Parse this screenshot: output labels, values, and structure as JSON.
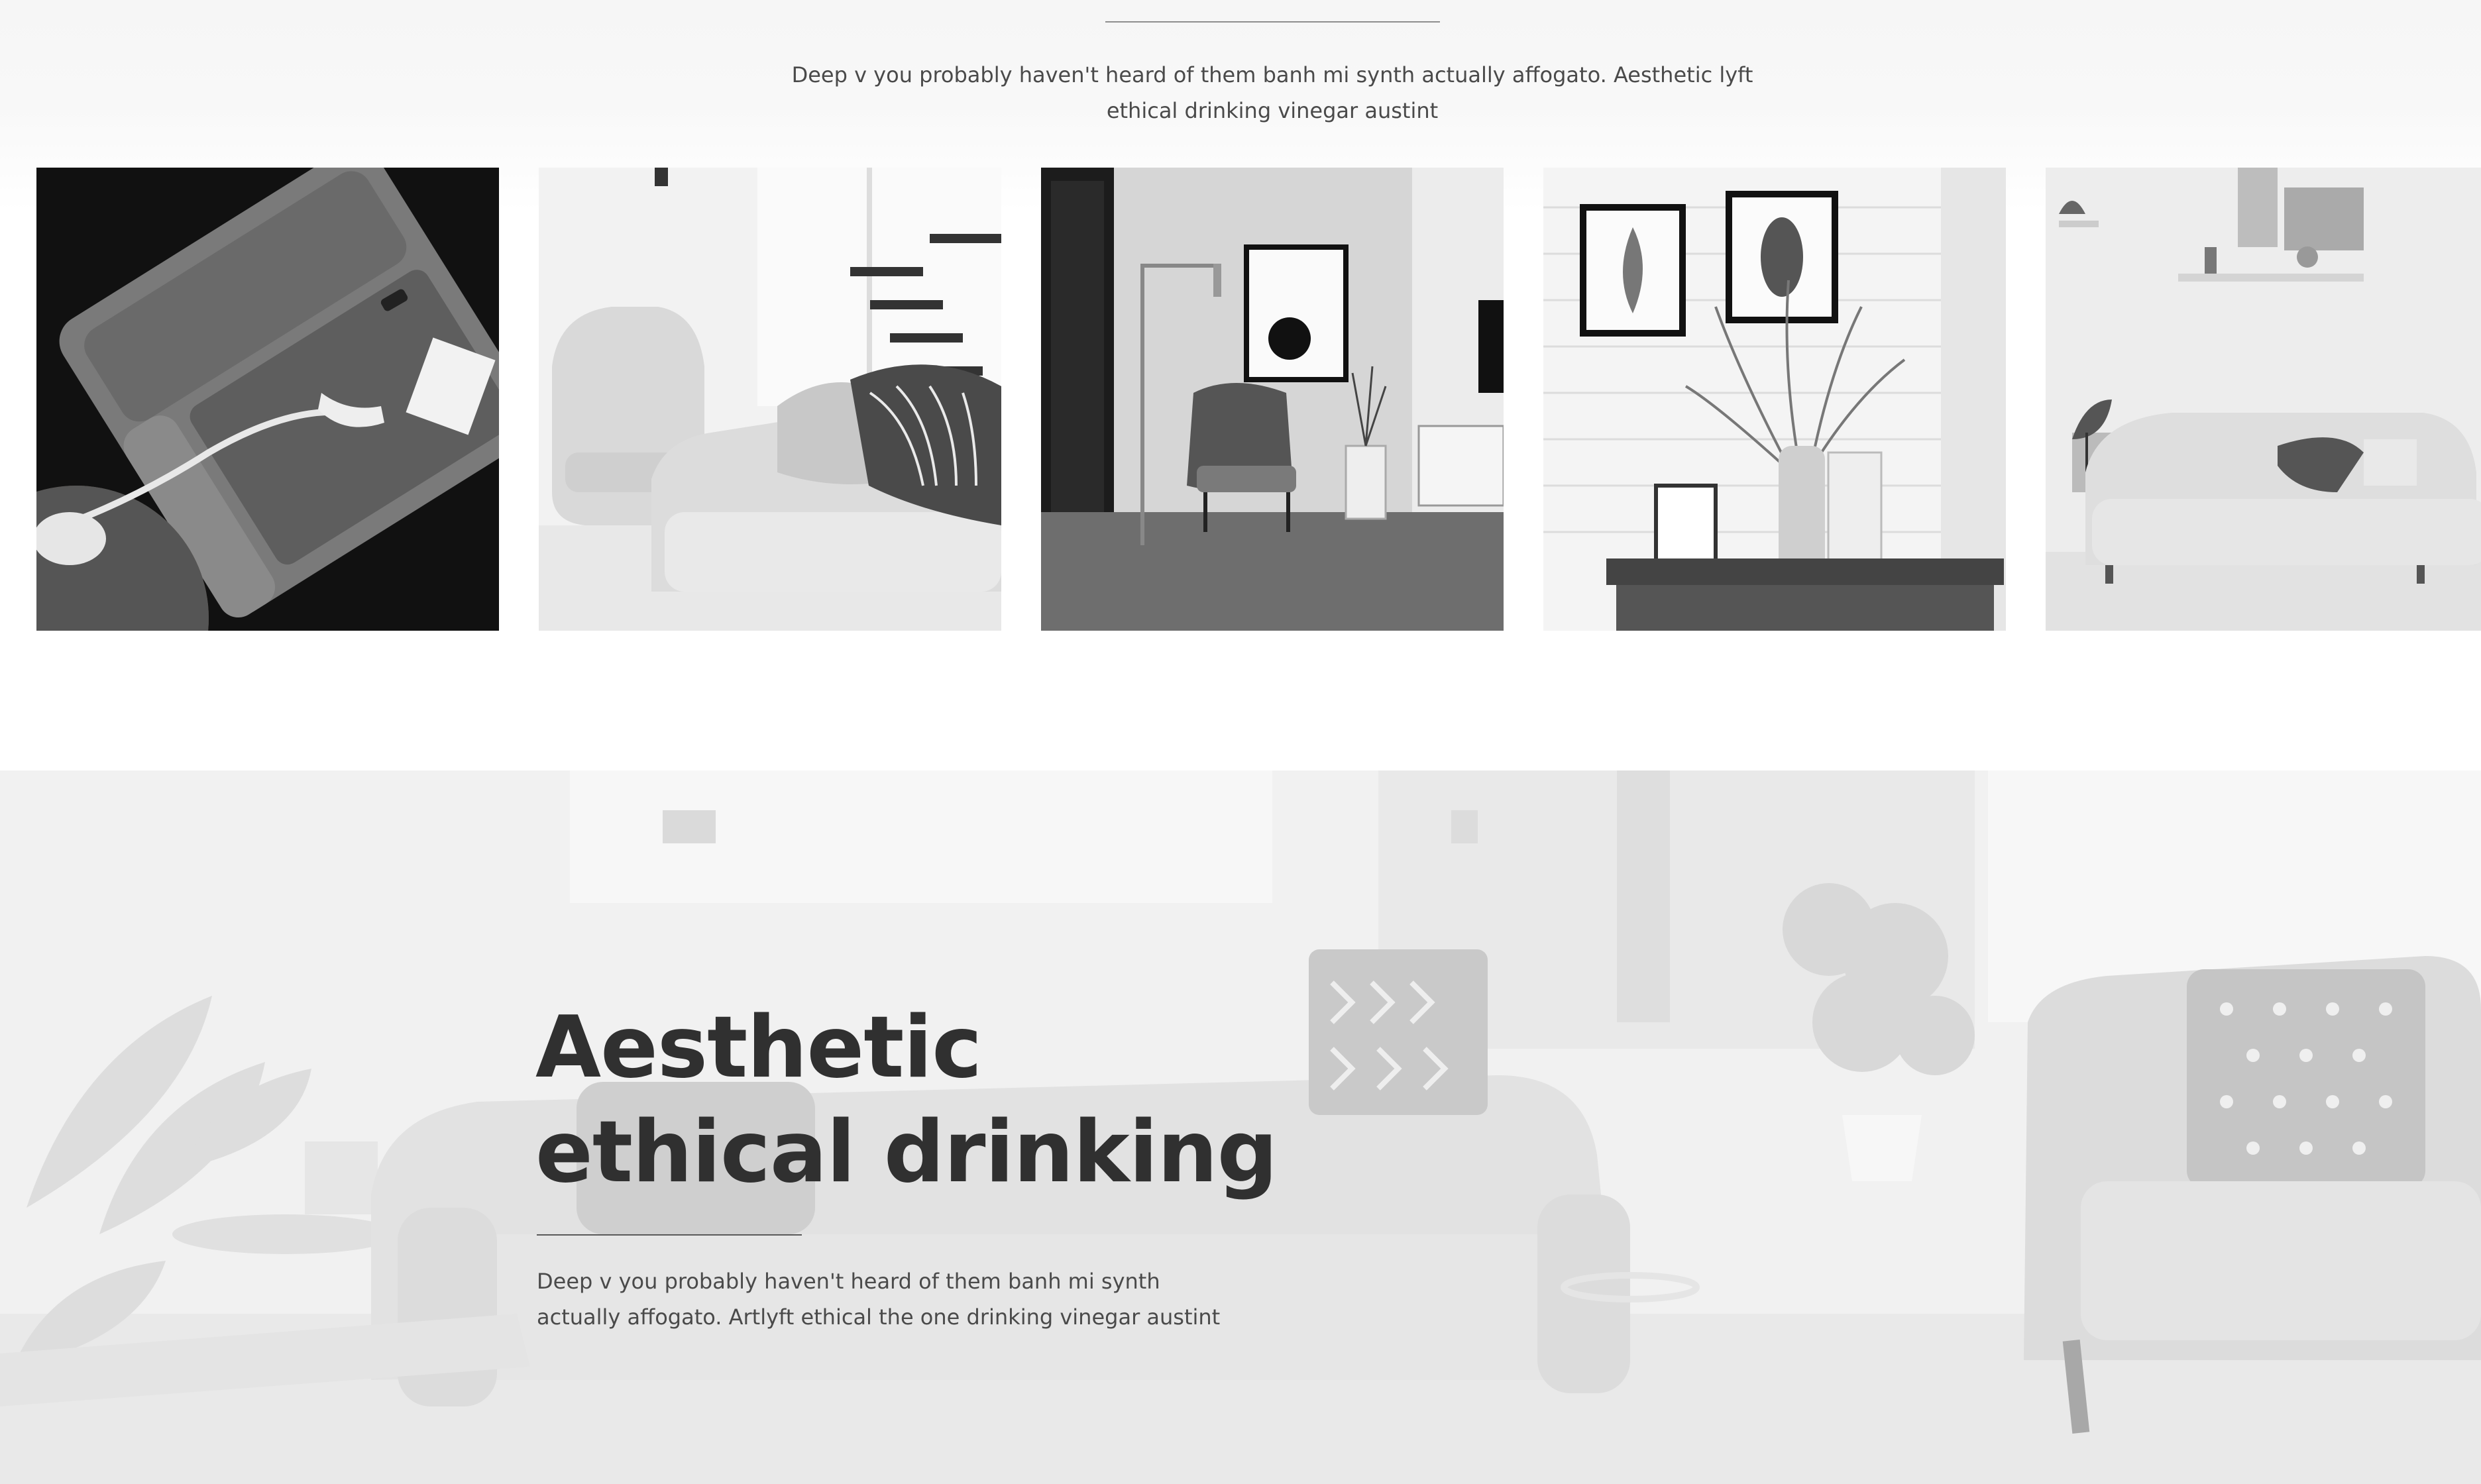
{
  "gallery": {
    "intro_text": "Deep v you probably haven't heard of them banh mi synth actually affogato. Aesthetic lyft ethical drinking vinegar austint",
    "photos": [
      {
        "subject": "sofa-with-telephone"
      },
      {
        "subject": "armchair-and-sofa-by-stairs"
      },
      {
        "subject": "chair-with-floor-lamp"
      },
      {
        "subject": "framed-prints-and-vase"
      },
      {
        "subject": "sofa-with-shelf"
      }
    ]
  },
  "hero": {
    "title_line1": "Aesthetic",
    "title_line2": "ethical drinking",
    "text": "Deep v you probably haven't heard of them banh mi synth actually affogato. Artlyft ethical the one drinking vinegar austint"
  },
  "colors": {
    "heading": "#303030",
    "body_text": "#4a4a4a",
    "divider": "#8e8e8e",
    "hero_background": "#f1f1f1"
  }
}
